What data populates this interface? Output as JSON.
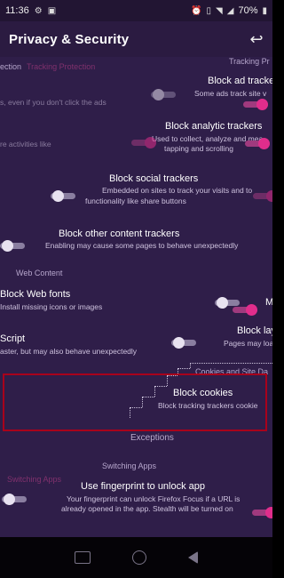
{
  "status_bar": {
    "time": "11:36",
    "battery": "70%"
  },
  "app_bar": {
    "title": "Privacy & Security"
  },
  "tracking": {
    "header_left": "ection",
    "header_left_pink": "Tracking Protection",
    "header_right": "Tracking Pr",
    "ads": {
      "title": "Block ad tracke",
      "sub": "Some ads track site v"
    },
    "ads_ghost_sub": "s, even if you don't click the ads",
    "analytic": {
      "title": "Block analytic trackers",
      "sub1": "Used to collect, analyze and mea",
      "sub2": "tapping and scrolling"
    },
    "analytic_ghost_sub": "re activities like",
    "social": {
      "title": "Block social trackers",
      "sub1": "Embedded on sites to track your visits and to",
      "sub2": "functionality like share buttons"
    },
    "other": {
      "title": "Block other content trackers",
      "sub": "Enabling may cause some pages to behave unexpectedly"
    }
  },
  "web_content": {
    "header": "Web Content",
    "fonts": {
      "title": "Block Web fonts",
      "sub": "Install missing icons or images"
    },
    "script": {
      "title": "Script",
      "sub": "aster, but may also behave unexpectedly"
    },
    "layout_right": {
      "title": "Block lay",
      "sub": "Pages may loa"
    },
    "more_right": "M"
  },
  "cookies": {
    "header_right": "Cookies and Site Da",
    "title": "Block cookies",
    "sub": "Block tracking trackers cookie"
  },
  "exceptions": "Exceptions",
  "switching": {
    "header": "Switching Apps",
    "header_pink": "Switching Apps",
    "fingerprint": {
      "title": "Use fingerprint to unlock app",
      "sub1": "Your fingerprint can unlock Firefox Focus if a URL is",
      "sub2": "already opened in the app. Stealth will be turned on"
    }
  },
  "colors": {
    "accent": "#e12d8c",
    "background": "#2f1e49",
    "highlight": "#a8001b"
  }
}
